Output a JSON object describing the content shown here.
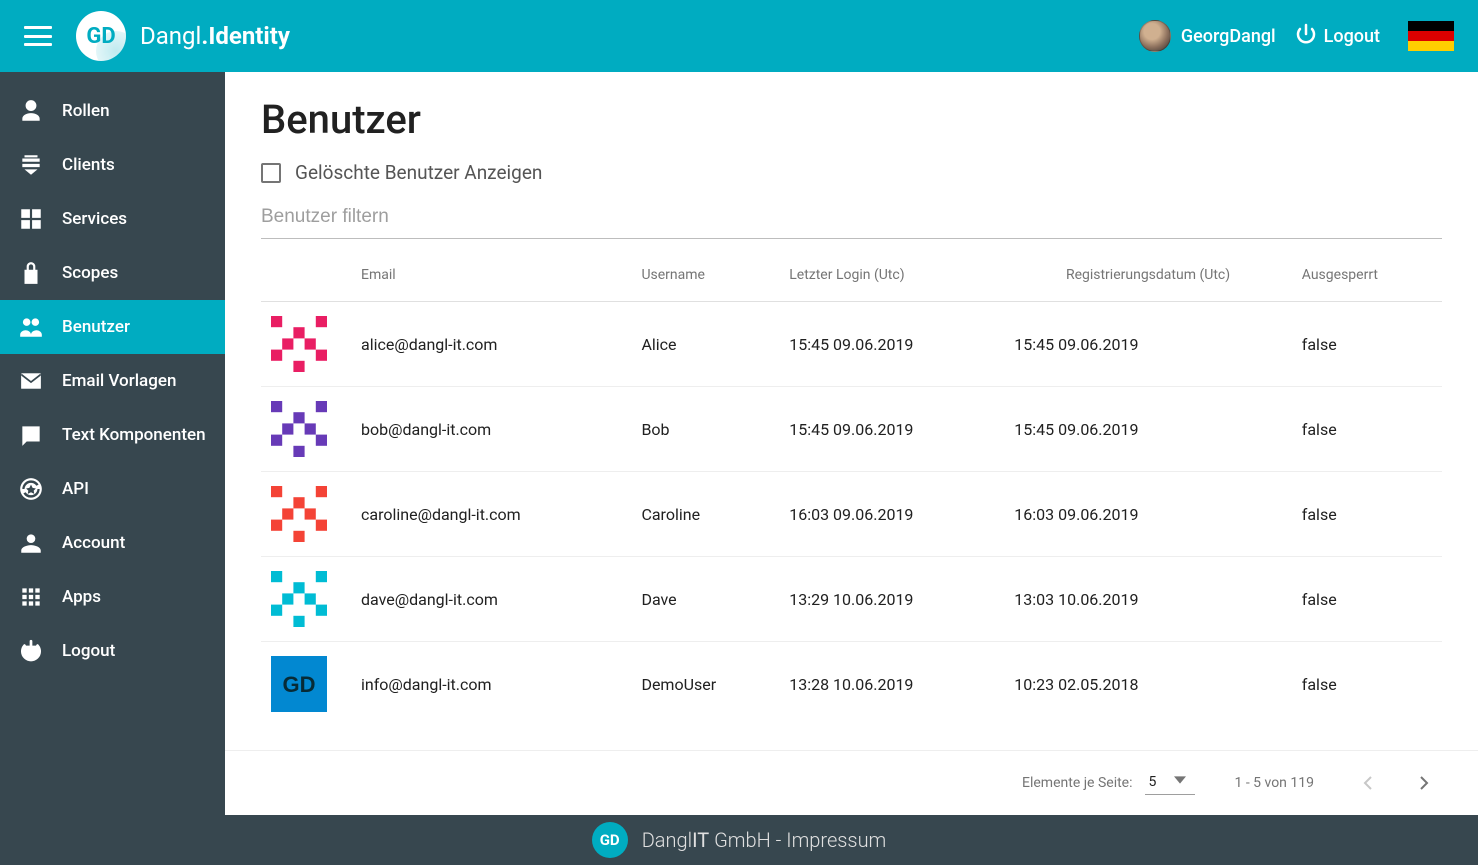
{
  "header": {
    "brand_light": "Dangl",
    "brand_bold": ".Identity",
    "logo_text": "GD",
    "user_name": "GeorgDangl",
    "logout_label": "Logout",
    "flag_country": "germany"
  },
  "sidebar": {
    "items": [
      {
        "label": "Rollen",
        "icon": "roles"
      },
      {
        "label": "Clients",
        "icon": "clients"
      },
      {
        "label": "Services",
        "icon": "services"
      },
      {
        "label": "Scopes",
        "icon": "scopes"
      },
      {
        "label": "Benutzer",
        "icon": "users",
        "selected": true
      },
      {
        "label": "Email Vorlagen",
        "icon": "email"
      },
      {
        "label": "Text Komponenten",
        "icon": "text"
      },
      {
        "label": "API",
        "icon": "api"
      },
      {
        "label": "Account",
        "icon": "account"
      },
      {
        "label": "Apps",
        "icon": "apps"
      },
      {
        "label": "Logout",
        "icon": "logout"
      }
    ]
  },
  "page": {
    "title": "Benutzer",
    "show_deleted_label": "Gelöschte Benutzer Anzeigen",
    "filter_placeholder": "Benutzer filtern"
  },
  "table": {
    "columns": {
      "email": "Email",
      "username": "Username",
      "last_login": "Letzter Login (Utc)",
      "registration": "Registrierungsdatum (Utc)",
      "locked": "Ausgesperrt"
    },
    "rows": [
      {
        "avatar_color": "#e91e63",
        "email": "alice@dangl-it.com",
        "username": "Alice",
        "last_login": "15:45 09.06.2019",
        "registration": "15:45 09.06.2019",
        "locked": "false"
      },
      {
        "avatar_color": "#673ab7",
        "email": "bob@dangl-it.com",
        "username": "Bob",
        "last_login": "15:45 09.06.2019",
        "registration": "15:45 09.06.2019",
        "locked": "false"
      },
      {
        "avatar_color": "#f44336",
        "email": "caroline@dangl-it.com",
        "username": "Caroline",
        "last_login": "16:03 09.06.2019",
        "registration": "16:03 09.06.2019",
        "locked": "false"
      },
      {
        "avatar_color": "#00bcd4",
        "email": "dave@dangl-it.com",
        "username": "Dave",
        "last_login": "13:29 10.06.2019",
        "registration": "13:03 10.06.2019",
        "locked": "false"
      },
      {
        "avatar_color": "#0288d1",
        "avatar_text": "GD",
        "email": "info@dangl-it.com",
        "username": "DemoUser",
        "last_login": "13:28 10.06.2019",
        "registration": "10:23 02.05.2018",
        "locked": "false"
      }
    ]
  },
  "paginator": {
    "items_per_page_label": "Elemente je Seite:",
    "page_size": "5",
    "range_label": "1 - 5 von 119"
  },
  "footer": {
    "logo_text": "GD",
    "company_prefix": "Dangl",
    "company_bold": "IT",
    "company_suffix": " GmbH - Impressum"
  }
}
